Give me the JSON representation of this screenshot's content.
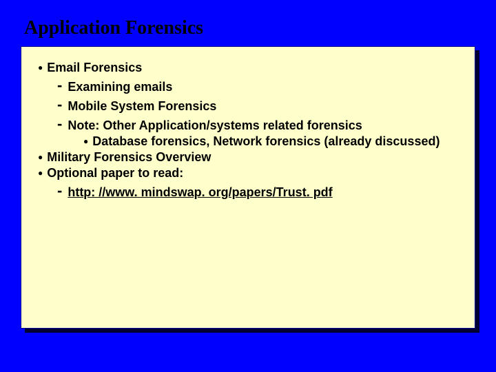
{
  "title": "Application Forensics",
  "bullets": {
    "b1": "Email Forensics",
    "b1a": "Examining emails",
    "b1b": "Mobile System Forensics",
    "b1c": "Note: Other Application/systems related forensics",
    "b1c1": "Database forensics, Network forensics (already discussed)",
    "b2": "Military Forensics Overview",
    "b3": "Optional paper to read:",
    "b3a": "http: //www. mindswap. org/papers/Trust. pdf"
  }
}
